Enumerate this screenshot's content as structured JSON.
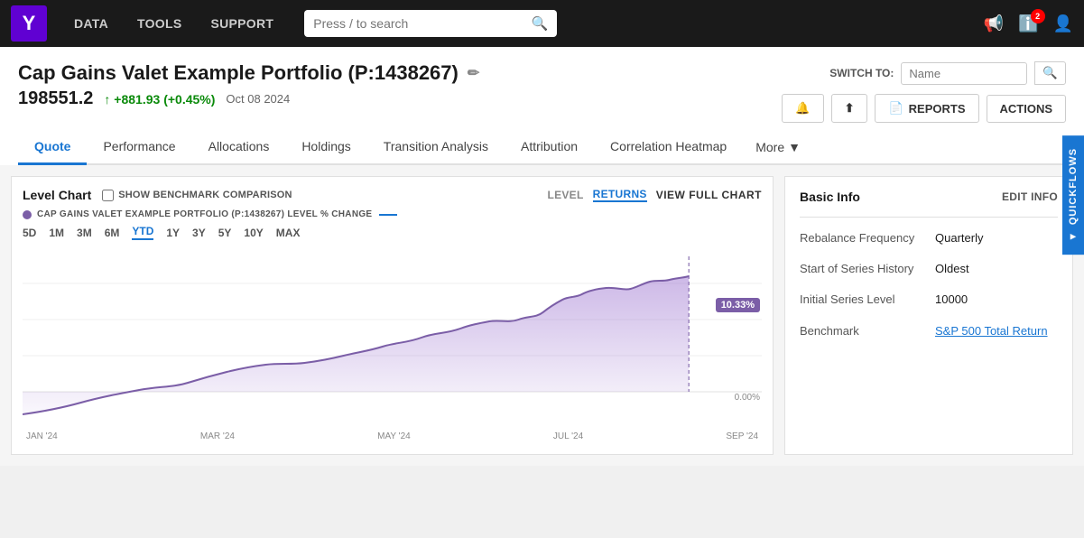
{
  "navbar": {
    "logo": "Y",
    "nav_items": [
      "DATA",
      "TOOLS",
      "SUPPORT"
    ],
    "search_placeholder": "Press / to search",
    "notification_count": "2"
  },
  "header": {
    "title": "Cap Gains Valet Example Portfolio (P:1438267)",
    "price": "198551.2",
    "change": "↑ +881.93 (+0.45%)",
    "date": "Oct 08 2024",
    "switch_to_label": "SWITCH TO:",
    "switch_to_placeholder": "Name",
    "edit_icon": "✏"
  },
  "action_buttons": {
    "alert": "🔔",
    "share": "↗",
    "reports_label": "REPORTS",
    "actions_label": "ACTIONS",
    "quickflows_label": "QUICKFLOWS"
  },
  "tabs": [
    {
      "label": "Quote",
      "active": true
    },
    {
      "label": "Performance",
      "active": false
    },
    {
      "label": "Allocations",
      "active": false
    },
    {
      "label": "Holdings",
      "active": false
    },
    {
      "label": "Transition Analysis",
      "active": false
    },
    {
      "label": "Attribution",
      "active": false
    },
    {
      "label": "Correlation Heatmap",
      "active": false
    }
  ],
  "more_tab": "More",
  "chart": {
    "title": "Level Chart",
    "benchmark_label": "SHOW BENCHMARK COMPARISON",
    "type_level": "LEVEL",
    "type_returns": "RETURNS",
    "view_full": "VIEW FULL CHART",
    "legend_text": "CAP GAINS VALET EXAMPLE PORTFOLIO (P:1438267) LEVEL % CHANGE",
    "time_ranges": [
      "5D",
      "1M",
      "3M",
      "6M",
      "YTD",
      "1Y",
      "3Y",
      "5Y",
      "10Y",
      "MAX"
    ],
    "active_range": "YTD",
    "end_label": "10.33%",
    "zero_label": "0.00%",
    "x_labels": [
      "JAN '24",
      "MAR '24",
      "MAY '24",
      "JUL '24",
      "SEP '24"
    ]
  },
  "basic_info": {
    "title": "Basic Info",
    "edit_label": "EDIT INFO",
    "rows": [
      {
        "label": "Rebalance Frequency",
        "value": "Quarterly"
      },
      {
        "label": "Start of Series History",
        "value": "Oldest"
      },
      {
        "label": "Initial Series Level",
        "value": "10000"
      },
      {
        "label": "Benchmark",
        "value": "S&P 500 Total Return",
        "link": true
      }
    ]
  }
}
